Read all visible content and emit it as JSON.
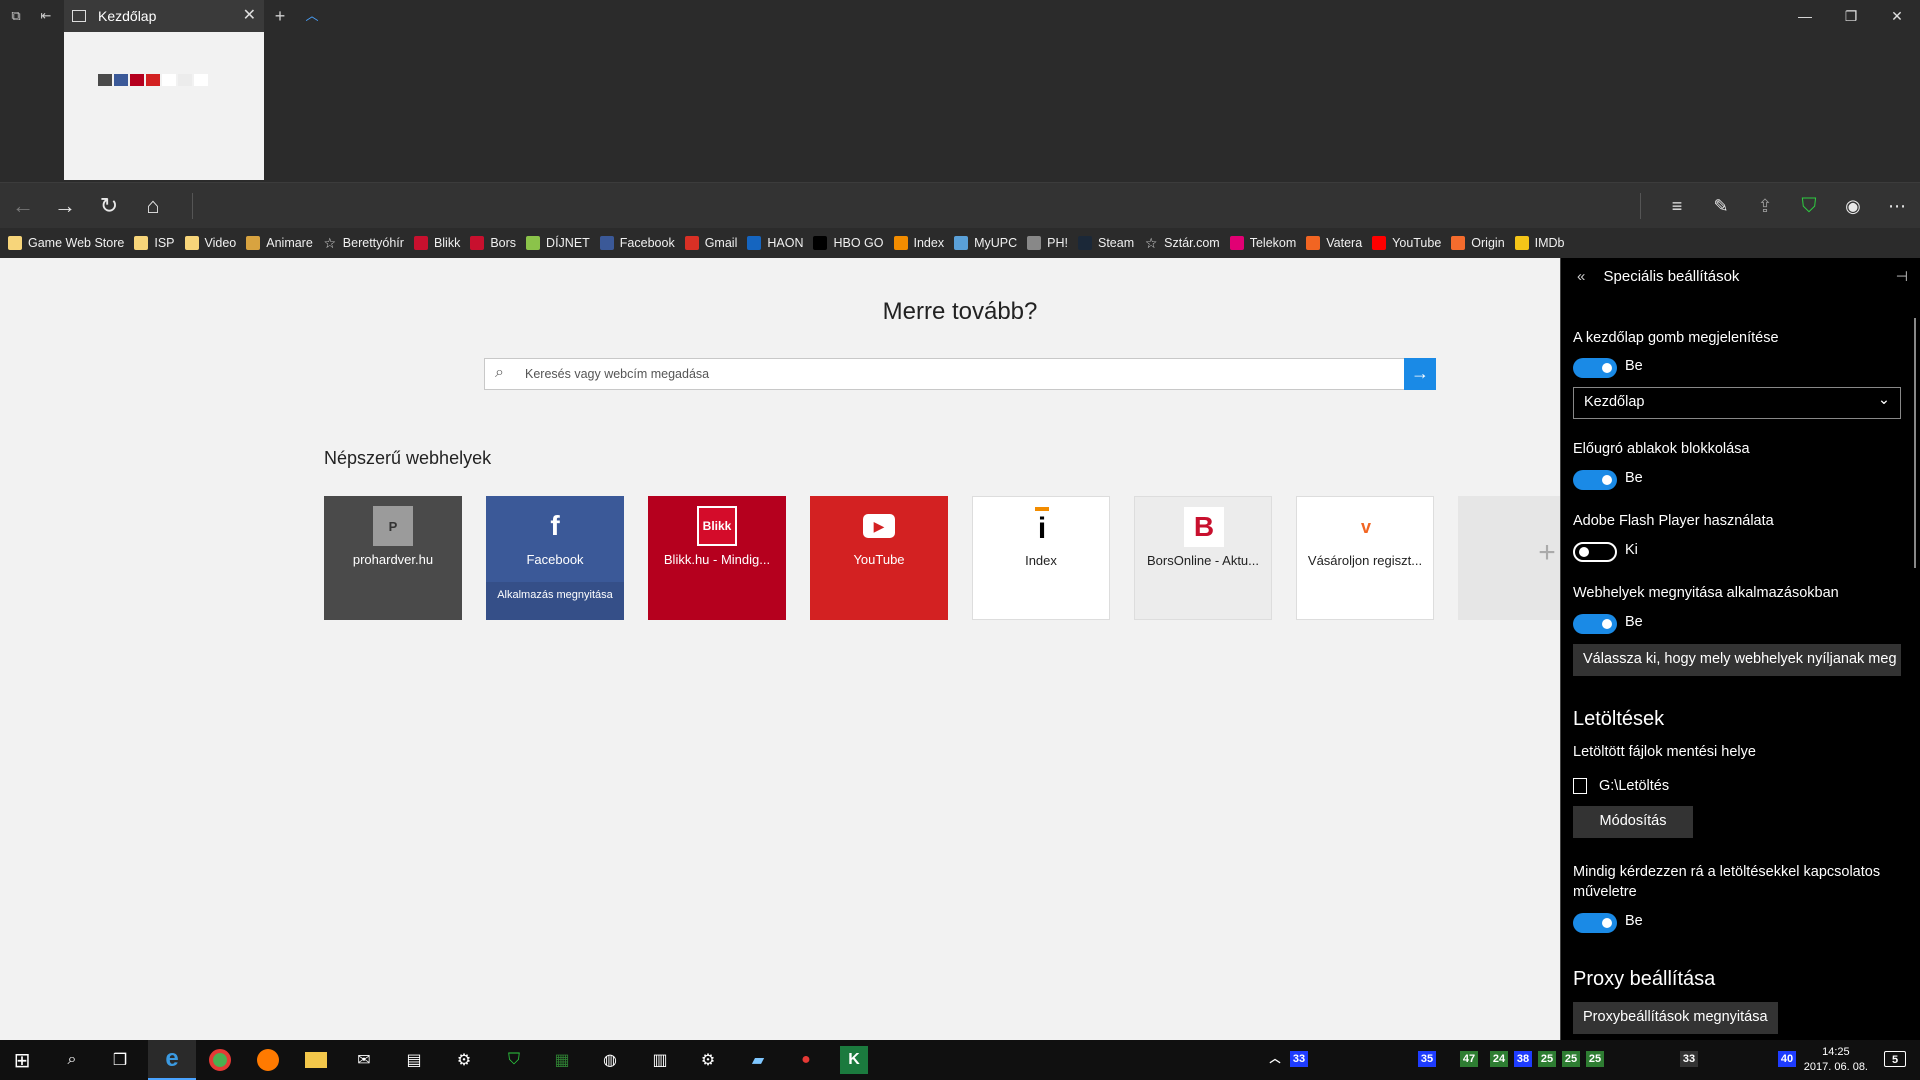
{
  "tab": {
    "title": "Kezdőlap"
  },
  "favorites": [
    {
      "label": "Game Web Store",
      "icon": "folder-icon",
      "color": "#f7d57a"
    },
    {
      "label": "ISP",
      "icon": "folder-icon",
      "color": "#f7d57a"
    },
    {
      "label": "Video",
      "icon": "folder-icon",
      "color": "#f7d57a"
    },
    {
      "label": "Animare",
      "icon": "animare-icon",
      "color": "#d8a340"
    },
    {
      "label": "Berettyóhír",
      "icon": "star-icon",
      "color": "#cccccc"
    },
    {
      "label": "Blikk",
      "icon": "blikk-icon",
      "color": "#c8102e"
    },
    {
      "label": "Bors",
      "icon": "bors-icon",
      "color": "#c8102e"
    },
    {
      "label": "DÍJNET",
      "icon": "dijnet-icon",
      "color": "#8bc34a"
    },
    {
      "label": "Facebook",
      "icon": "facebook-icon",
      "color": "#3b5998"
    },
    {
      "label": "Gmail",
      "icon": "gmail-icon",
      "color": "#d93025"
    },
    {
      "label": "HAON",
      "icon": "haon-icon",
      "color": "#1565c0"
    },
    {
      "label": "HBO GO",
      "icon": "hbo-icon",
      "color": "#000000"
    },
    {
      "label": "Index",
      "icon": "index-icon",
      "color": "#f28c00"
    },
    {
      "label": "MyUPC",
      "icon": "upc-icon",
      "color": "#5aa0d8"
    },
    {
      "label": "PH!",
      "icon": "ph-icon",
      "color": "#888888"
    },
    {
      "label": "Steam",
      "icon": "steam-icon",
      "color": "#1b2838"
    },
    {
      "label": "Sztár.com",
      "icon": "star-icon",
      "color": "#cccccc"
    },
    {
      "label": "Telekom",
      "icon": "telekom-icon",
      "color": "#e20074"
    },
    {
      "label": "Vatera",
      "icon": "vatera-icon",
      "color": "#f26522"
    },
    {
      "label": "YouTube",
      "icon": "youtube-icon",
      "color": "#ff0000"
    },
    {
      "label": "Origin",
      "icon": "origin-icon",
      "color": "#f56c2d"
    },
    {
      "label": "IMDb",
      "icon": "imdb-icon",
      "color": "#f5c518"
    }
  ],
  "page": {
    "heading": "Merre tovább?",
    "search_placeholder": "Keresés vagy webcím megadása",
    "sites_title": "Népszerű webhelyek"
  },
  "tiles": [
    {
      "label": "prohardver.hu",
      "bg": "#4a4a4a",
      "fg": "#ffffff",
      "logo": "P",
      "logo_bg": "#9b9b9b"
    },
    {
      "label": "Facebook",
      "bg": "#3b5998",
      "fg": "#ffffff",
      "logo": "f",
      "logo_bg": "#3b5998",
      "sub": "Alkalmazás megnyitása"
    },
    {
      "label": "Blikk.hu - Mindig...",
      "bg": "#b5001e",
      "fg": "#ffffff",
      "logo": "Blikk",
      "logo_bg": "#d40c2a"
    },
    {
      "label": "YouTube",
      "bg": "#d32122",
      "fg": "#ffffff",
      "logo": "▶",
      "logo_bg": "#ffffff"
    },
    {
      "label": "Index",
      "bg": "#ffffff",
      "fg": "#222222",
      "logo": "i",
      "logo_bg": "#ffffff"
    },
    {
      "label": "BorsOnline - Aktu...",
      "bg": "#ececec",
      "fg": "#222222",
      "logo": "B",
      "logo_bg": "#ffffff"
    },
    {
      "label": "Vásároljon regiszt...",
      "bg": "#ffffff",
      "fg": "#222222",
      "logo": "v",
      "logo_bg": "#ffffff"
    }
  ],
  "panel": {
    "title": "Speciális beállítások",
    "home_button_label": "A kezdőlap gomb megjelenítése",
    "home_button_state": "Be",
    "home_select_value": "Kezdőlap",
    "popup_label": "Előugró ablakok blokkolása",
    "popup_state": "Be",
    "flash_label": "Adobe Flash Player használata",
    "flash_state": "Ki",
    "apps_label": "Webhelyek megnyitása alkalmazásokban",
    "apps_state": "Be",
    "apps_button": "Válassza ki, hogy mely webhelyek nyíljanak meg",
    "downloads_title": "Letöltések",
    "download_location_label": "Letöltött fájlok mentési helye",
    "download_path": "G:\\Letöltés",
    "change_button": "Módosítás",
    "ask_label_1": "Mindig kérdezzen rá a letöltésekkel kapcsolatos",
    "ask_label_2": "műveletre",
    "ask_state": "Be",
    "proxy_title": "Proxy beállítása",
    "proxy_button": "Proxybeállítások megnyitása"
  },
  "taskbar": {
    "time": "14:25",
    "date": "2017. 06. 08.",
    "notification_count": "5",
    "tray_numbers": [
      "33",
      "35",
      "47",
      "24",
      "38",
      "25",
      "25",
      "25",
      "33",
      "40"
    ]
  }
}
